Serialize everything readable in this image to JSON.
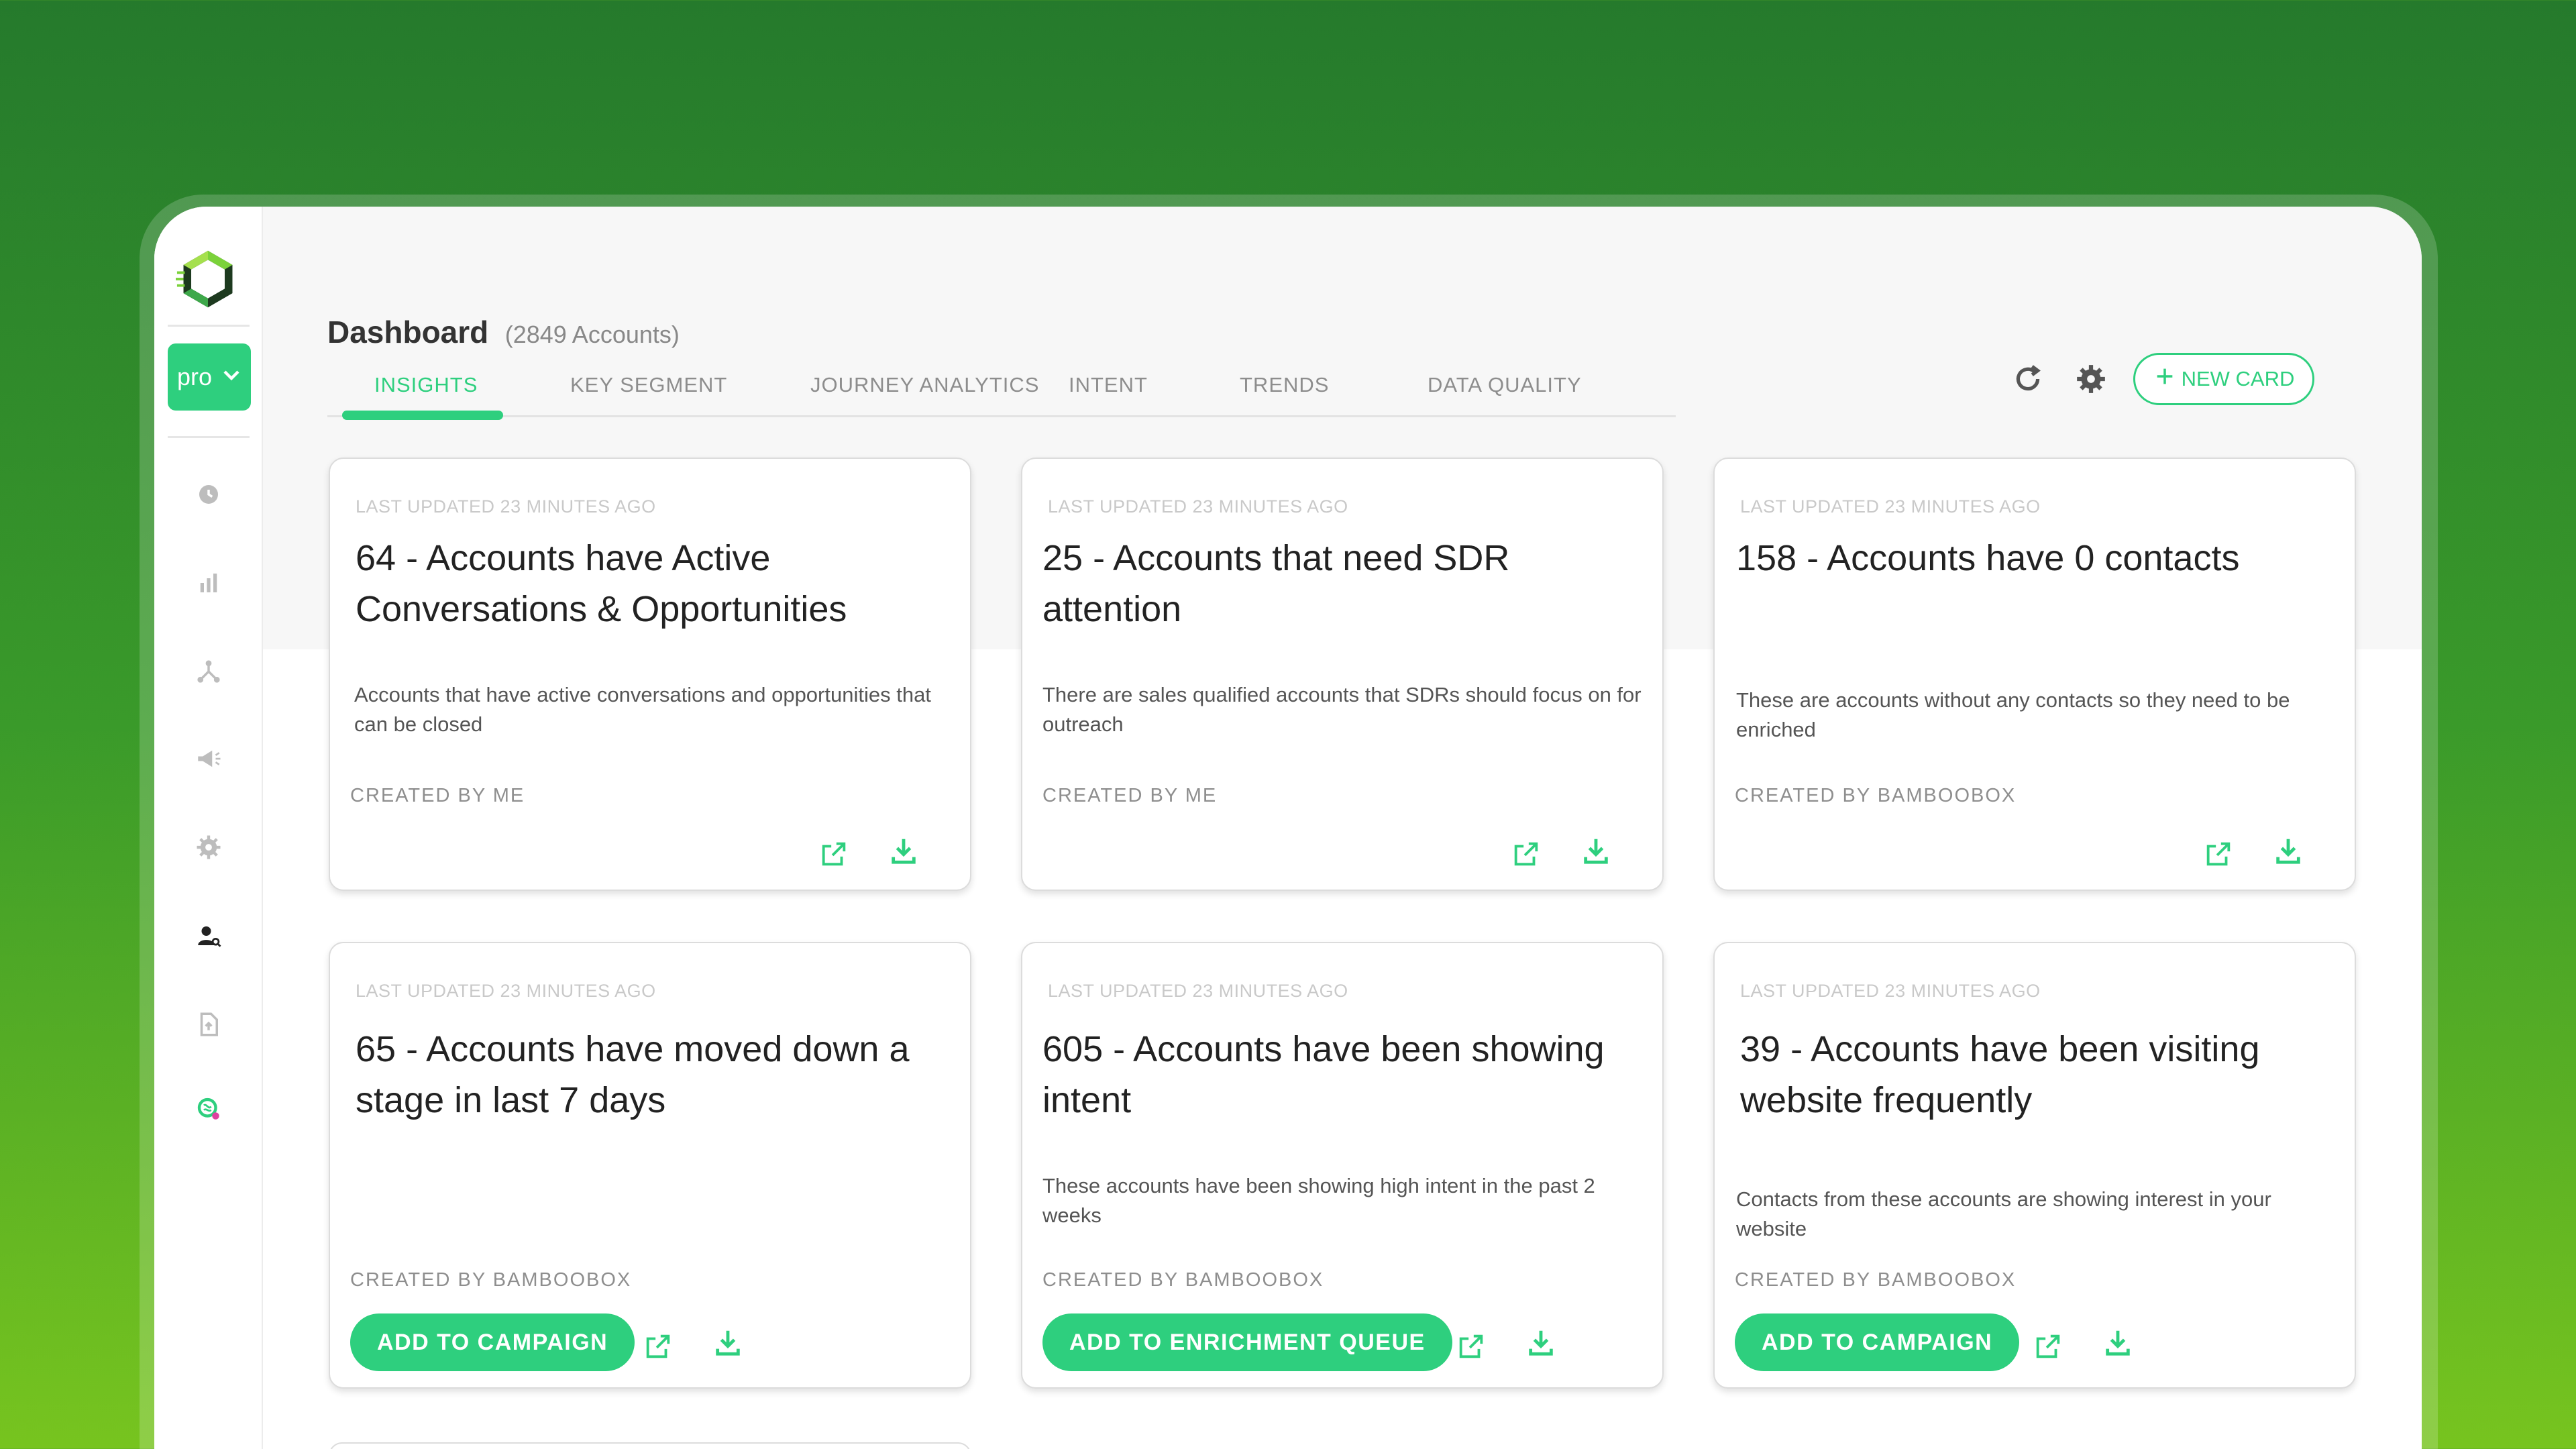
{
  "app": {
    "plan_label": "pro",
    "brand_color": "#2ecf7e"
  },
  "header": {
    "title": "Dashboard",
    "subtitle": "(2849  Accounts)"
  },
  "tabs": [
    {
      "label": "INSIGHTS",
      "active": true
    },
    {
      "label": "KEY SEGMENT",
      "active": false
    },
    {
      "label": "JOURNEY ANALYTICS",
      "active": false
    },
    {
      "label": "INTENT",
      "active": false
    },
    {
      "label": "TRENDS",
      "active": false
    },
    {
      "label": "DATA QUALITY",
      "active": false
    }
  ],
  "toolbar": {
    "new_card_label": "NEW CARD",
    "icons": [
      "refresh-icon",
      "gear-icon",
      "plus-icon"
    ]
  },
  "sidebar": {
    "icons": [
      "clock-icon",
      "bar-chart-icon",
      "network-icon",
      "megaphone-icon",
      "gear-icon",
      "user-search-icon",
      "file-upload-icon",
      "brain-icon"
    ]
  },
  "cards": [
    {
      "updated": "LAST UPDATED 23 MINUTES AGO",
      "title": "64 - Accounts have Active Conversations & Opportunities",
      "description": "Accounts that have active conversations and opportunities that can be closed",
      "creator": "CREATED BY ME",
      "cta": ""
    },
    {
      "updated": "LAST UPDATED 23 MINUTES AGO",
      "title": "25 - Accounts that need SDR attention",
      "description": "There are sales qualified accounts that SDRs should focus on for outreach",
      "creator": "CREATED BY ME",
      "cta": ""
    },
    {
      "updated": "LAST UPDATED 23 MINUTES AGO",
      "title": "158 - Accounts have 0 contacts",
      "description": "These are accounts without any contacts so they need to be enriched",
      "creator": "CREATED BY BAMBOOBOX",
      "cta": ""
    },
    {
      "updated": "LAST UPDATED 23 MINUTES AGO",
      "title": "65 - Accounts have moved down a stage in last 7 days",
      "description": "",
      "creator": "CREATED BY BAMBOOBOX",
      "cta": "ADD TO CAMPAIGN"
    },
    {
      "updated": "LAST UPDATED 23 MINUTES AGO",
      "title": "605 - Accounts have been showing intent",
      "description": "These accounts have been showing high intent in the past 2 weeks",
      "creator": "CREATED BY BAMBOOBOX",
      "cta": "ADD TO ENRICHMENT QUEUE"
    },
    {
      "updated": "LAST UPDATED 23 MINUTES AGO",
      "title": "39 - Accounts have been visiting website frequently",
      "description": "Contacts from these accounts are showing interest in your website",
      "creator": "CREATED BY BAMBOOBOX",
      "cta": "ADD TO CAMPAIGN"
    }
  ]
}
